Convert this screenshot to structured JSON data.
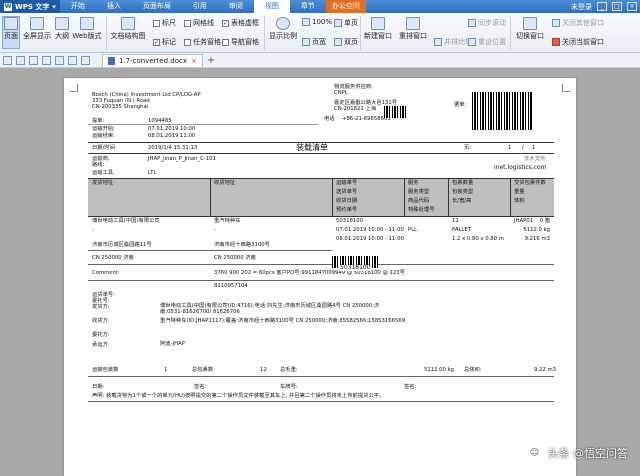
{
  "titlebar": {
    "app_name": "WPS 文字",
    "menus": [
      "开始",
      "插入",
      "页面布局",
      "引用",
      "审阅",
      "视图",
      "章节"
    ],
    "active_menu": "视图",
    "office_space": "办公空间",
    "login": "未登录"
  },
  "ribbon": {
    "page": "页面",
    "full_screen": "全屏显示",
    "outline": "大纲",
    "web_layout": "Web版式",
    "doc_map": "文档结构图",
    "ruler": "标尺",
    "gridlines": "网格线",
    "table_gridlines": "表格虚框",
    "markup": "标记",
    "task_pane": "任务窗格",
    "nav_pane": "导航窗格",
    "zoom_pct": "100%",
    "single_page": "单页",
    "show_ratio": "显示比例",
    "page_width": "页宽",
    "two_pages": "双页",
    "new_window": "新建窗口",
    "arrange_window": "重排窗口",
    "side_by_side": "并排比较",
    "sync_scroll": "同步滚动",
    "reset_pos": "重设位置",
    "switch_window": "切换窗口",
    "close_other": "关闭其他窗口",
    "close_current": "关闭当前窗口"
  },
  "document_tab": {
    "filename": "1.7-converted.docx",
    "close": "×",
    "add": "+"
  },
  "document": {
    "shipper_lines": [
      "Bosch (China) Investment Ltd CP/LOG-AP",
      "333 Fuquan (N.) Road",
      "CN-200335 Shanghai"
    ],
    "provider_label": "物流服务供应商:",
    "provider_name": "CNPL",
    "provider_addr": "嘉定区嘉戬公路大邑131号",
    "provider_code": "CN-201821 上海",
    "provider_phone": "+86-21-69658601",
    "tel_label": "电话",
    "extra_label": "据单:",
    "doc_no_label": "提单:",
    "doc_no": "1094485",
    "start_label": "运输开始:",
    "start_val": "07.01.2019 10:00",
    "end_label": "运输结束:",
    "end_val": "08.01.2019 11:00",
    "date_label": "日期/时间:",
    "date_val": "2019/1/4 15:31:13",
    "title": "装载清单",
    "page_label": "页:",
    "page_no": "1",
    "page_sep": "/",
    "page_total": "1",
    "company_label": "运输商:",
    "company_val": "JHAP_Jinan_P_Jinan_C-101",
    "route_label": "路线:",
    "tool_label": "运输工具:",
    "tool_val": "LTL",
    "tech_label": "技术支持",
    "website": "inet.logistics.com",
    "col_h1": [
      "发货地址",
      "收货地址",
      "运输单号",
      "服务",
      "包裹数量",
      "交货包裹件数"
    ],
    "col_h2": [
      "送货单号",
      "服务类型",
      "包装类型",
      "重量"
    ],
    "col_h3": [
      "收货日期",
      "商品代码",
      "长/宽/高",
      "体积"
    ],
    "col_h4": [
      "预约单号",
      "特殊处理号"
    ],
    "row1": [
      "博世电动工具(中国)有限公司",
      "重汽特种车",
      "50318100",
      "",
      "12",
      "JHAP01",
      "0 箱"
    ],
    "row2": [
      "-",
      "-",
      "07.01.2019 10:00 - 11:00",
      "PLL",
      "PALLET",
      "",
      "5112.0 kg"
    ],
    "row3": [
      "",
      "",
      "08.01.2019 10:00 - 11:00",
      "",
      "1.2 x 0.80 x 0.80 m",
      "",
      "9.216 m3"
    ],
    "addr_from": "济南市历城区桑园路11号",
    "addr_to": "济南市经十西路3100号",
    "postcode_from": "CN 250000  济南",
    "postcode_to": "CN 250000  济南",
    "comment_label": "Comment:",
    "comment_val": "3760 900 202 = 60pcs  客户PO号:9911847009949 @ 50318100 @ 123号",
    "barcode_text": "50318100",
    "ref_no": "8110957104",
    "consignee_lines": [
      "运货单号:",
      "委托号:",
      "发货方:"
    ],
    "sender_full": "博世电动工具(中国)有限公司(ID:4716);电话:刘先生;济南市历城区桑园路4号 CN 250000;济",
    "sender_tel": "南;0531-81626700/ 81626706",
    "receiver_label": "收货方:",
    "receiver_full": "重汽特种车(ID:JHAP1117);覆盖:济南市经十西路3100号 CN 250000;济南;85582566;15853166569",
    "agent_label": "委托方:",
    "carrier_label": "承运方:",
    "carrier_val": "阿迪-JHAP",
    "pkg_label": "运输包装数",
    "pkg_val": "1",
    "total_label": "总包裹数:",
    "total_val": "12",
    "weight_label": "总毛重:",
    "weight_val": "5112.00 kg",
    "volume_label": "总体积:",
    "volume_val": "9.22 m3",
    "sign_date": "日期:",
    "sign_carrier": "签名:",
    "sign_name": "车牌号:",
    "sign_driver": "签名:",
    "note": "声明: 装载货物为1个或一个的单元(HU)按照提交的第二个操作员文件装载至其车上, 并且第二个操作员将未上传前提货公平。"
  },
  "watermark": {
    "text": "头条 @悟空问答",
    "icon": "face-icon"
  }
}
